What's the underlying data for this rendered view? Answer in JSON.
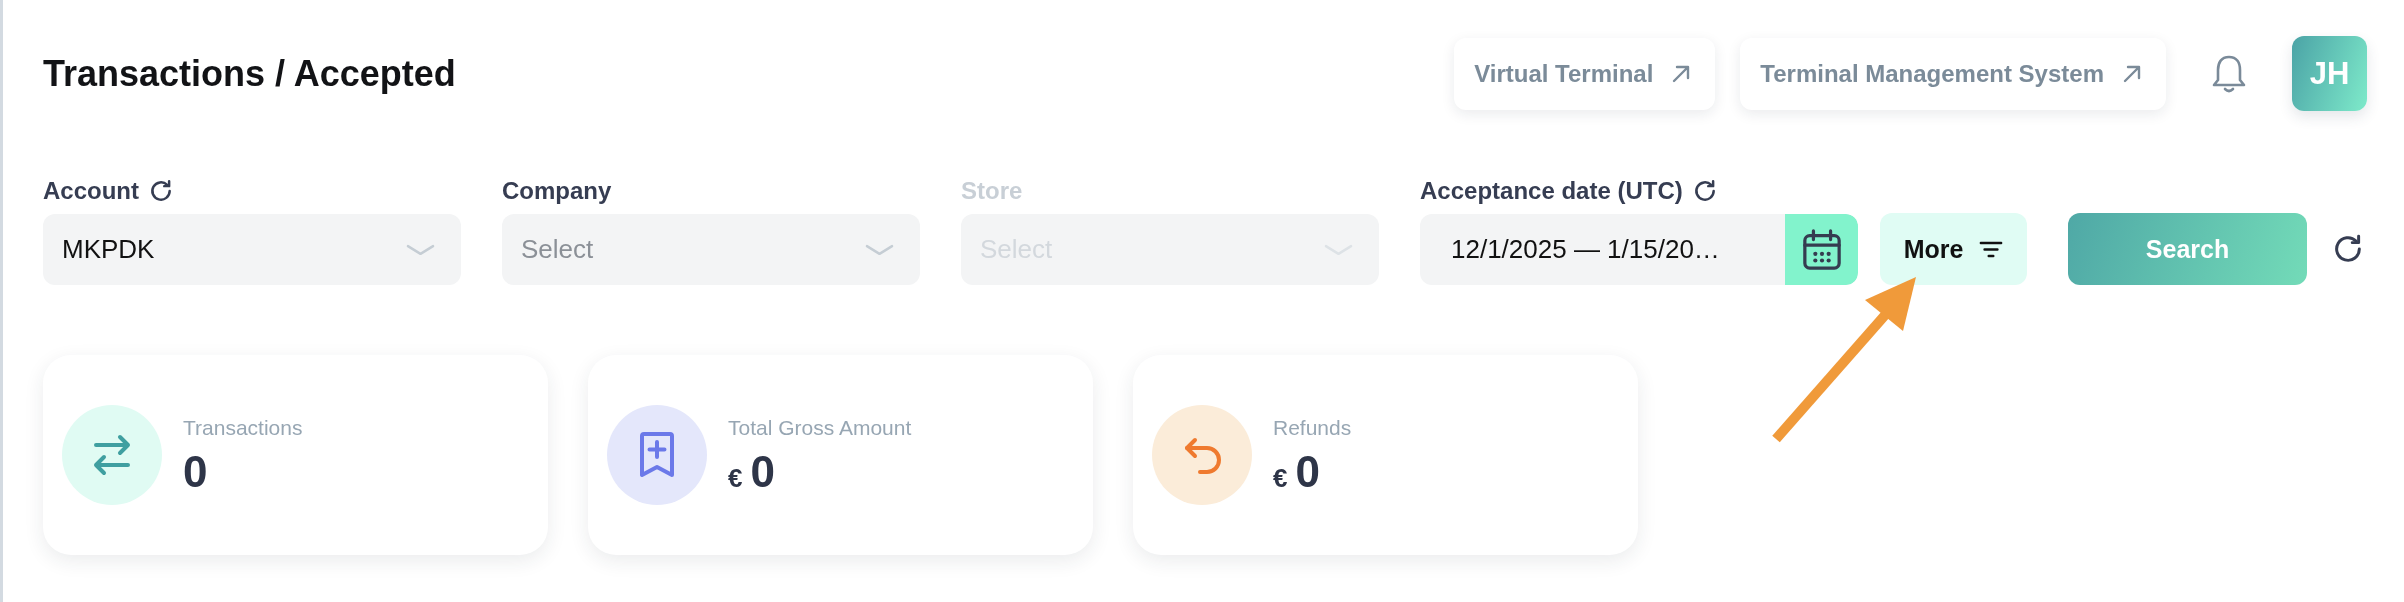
{
  "header": {
    "title": "Transactions / Accepted",
    "links": [
      {
        "label": "Virtual Terminal"
      },
      {
        "label": "Terminal Management System"
      }
    ],
    "avatar": {
      "initials": "JH"
    }
  },
  "filters": [
    {
      "kind": "select",
      "label": "Account",
      "has_reset": true,
      "disabled": false,
      "value": "MKPDK"
    },
    {
      "kind": "select",
      "label": "Company",
      "has_reset": false,
      "disabled": false,
      "placeholder": "Select"
    },
    {
      "kind": "select",
      "label": "Store",
      "has_reset": false,
      "disabled": true,
      "placeholder": "Select"
    },
    {
      "kind": "date",
      "label": "Acceptance date (UTC)",
      "has_reset": true,
      "disabled": false,
      "value": "12/1/2025 — 1/15/20…"
    }
  ],
  "more_button": {
    "label": "More"
  },
  "search_button": {
    "label": "Search"
  },
  "stats": [
    {
      "kind": "count",
      "label": "Transactions",
      "value": "0"
    },
    {
      "kind": "gross",
      "label": "Total Gross Amount",
      "currency": "€",
      "value": "0"
    },
    {
      "kind": "refunds",
      "label": "Refunds",
      "currency": "€",
      "value": "0"
    }
  ]
}
